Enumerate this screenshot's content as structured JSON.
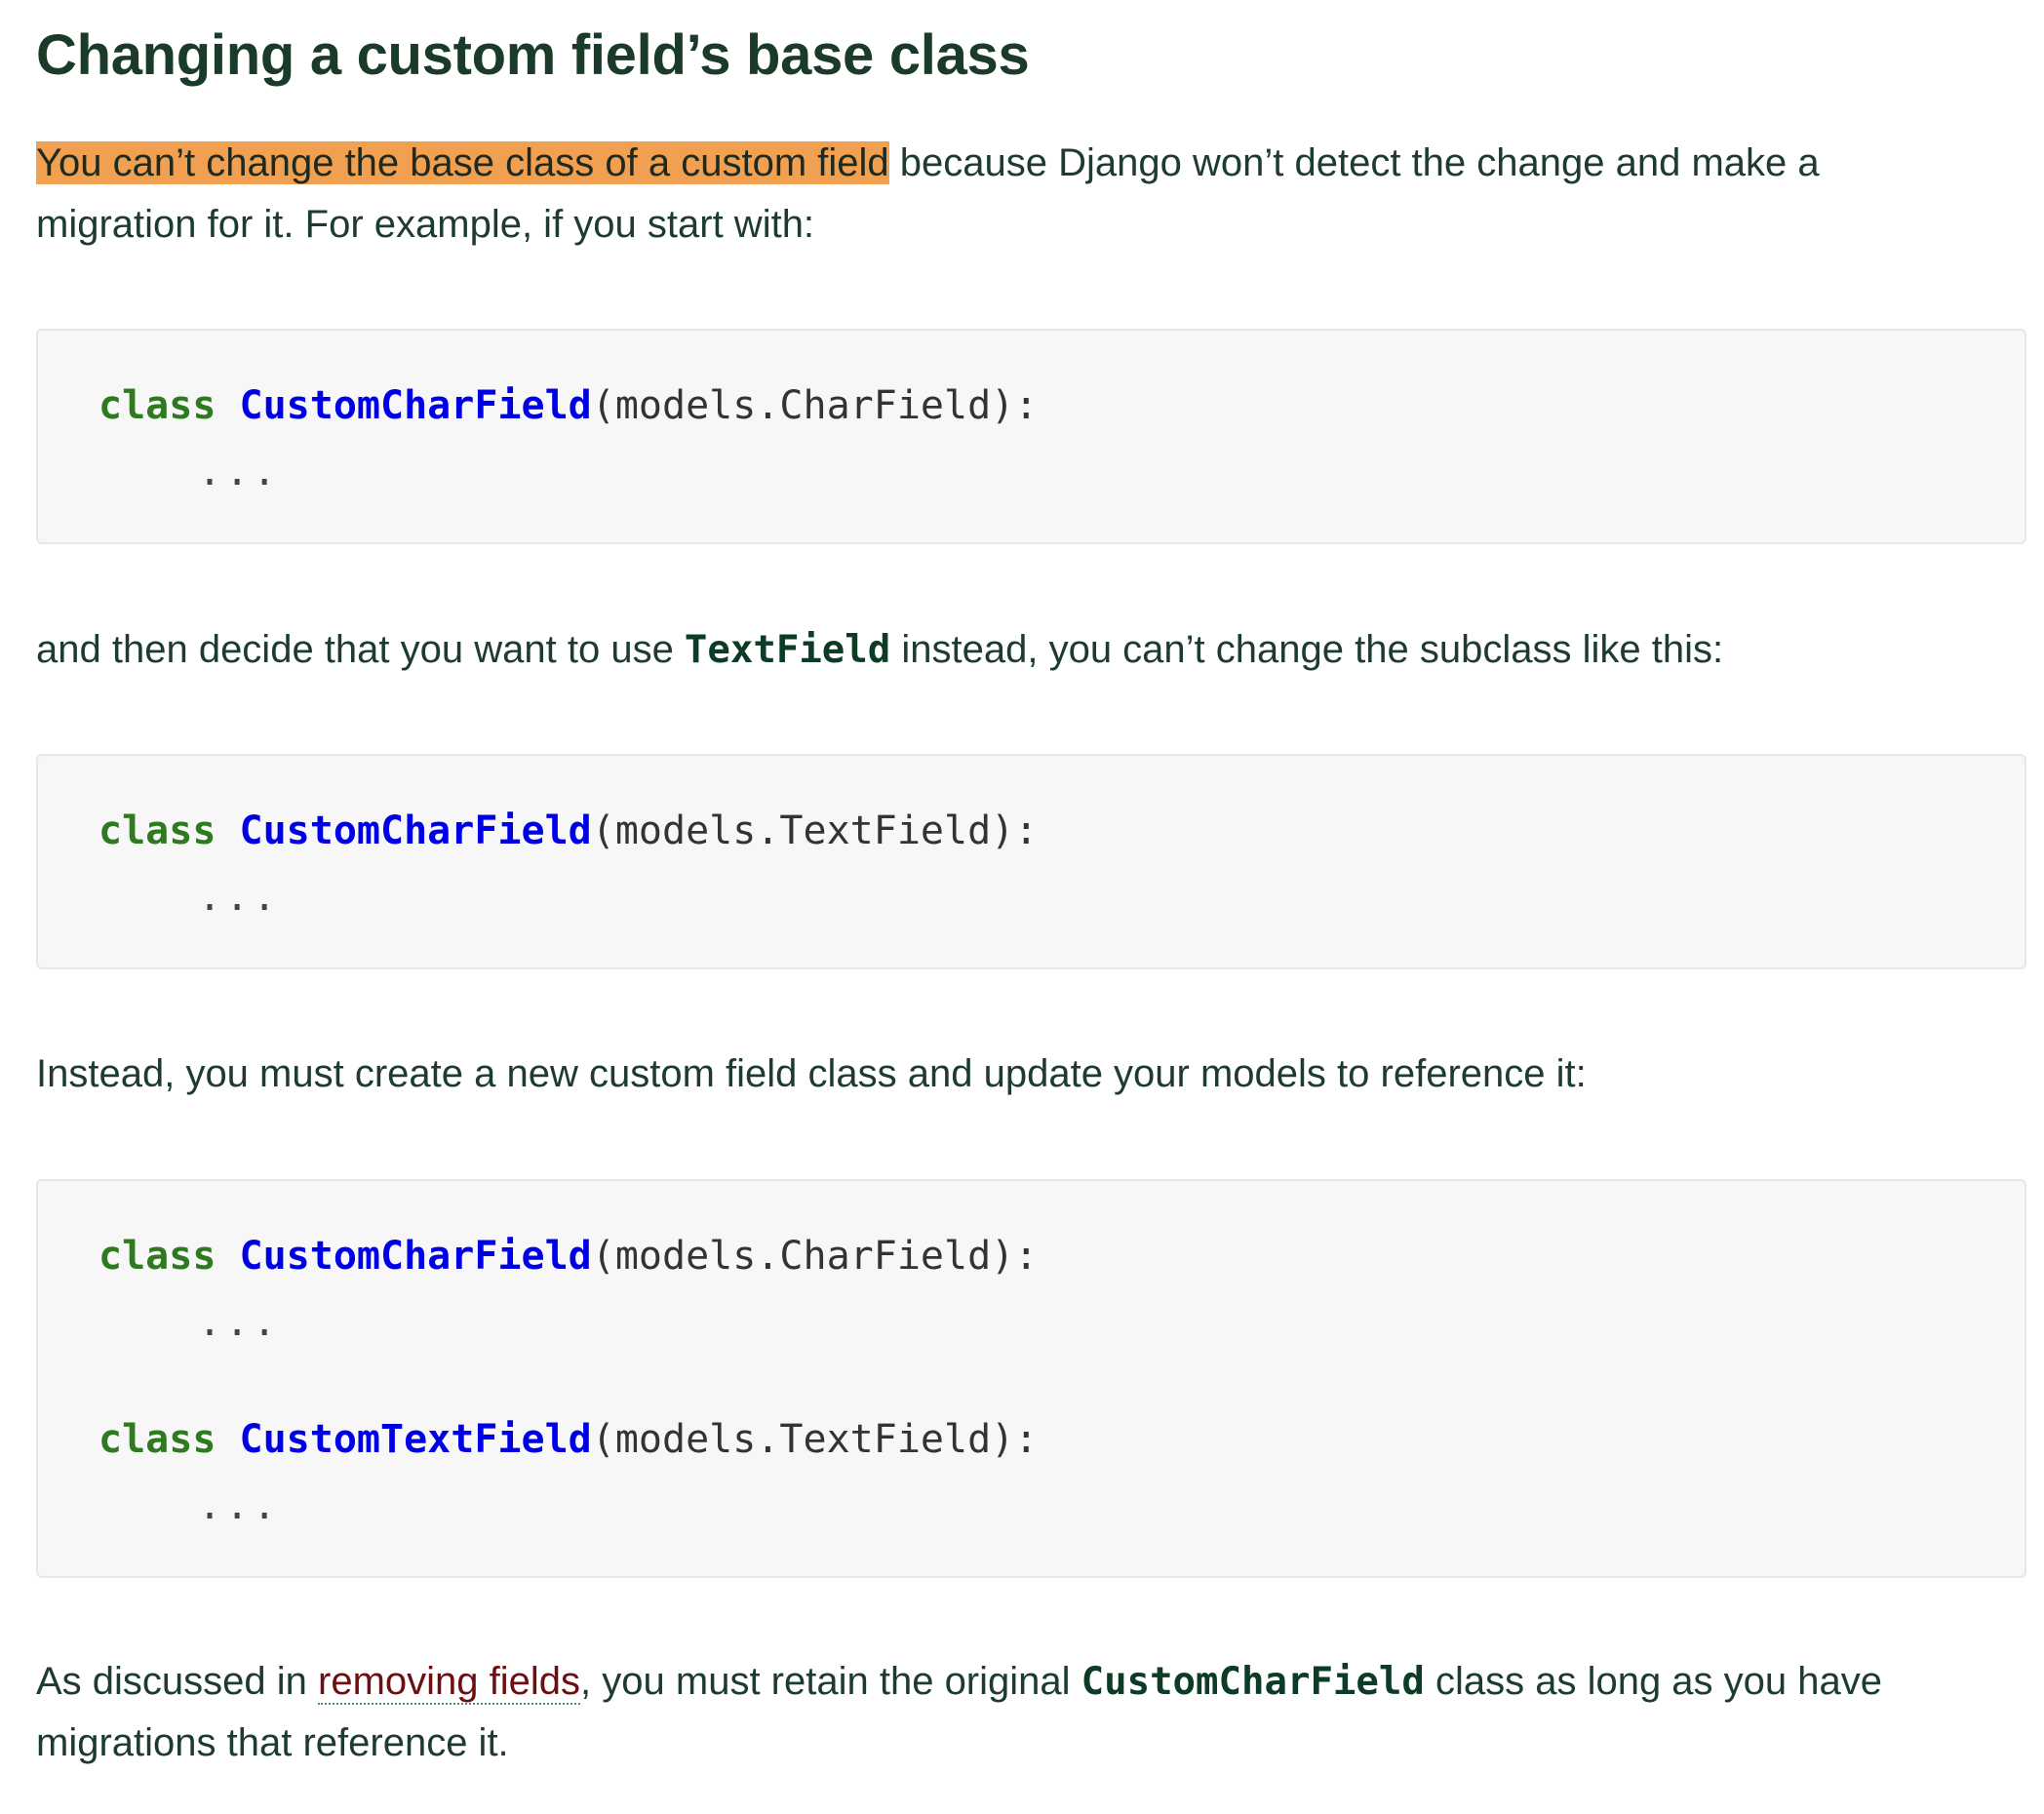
{
  "heading": "Changing a custom field’s base class",
  "para1": {
    "highlight": "You can’t change the base class of a custom field",
    "rest_line1": " because Django won’t detect the change and make a",
    "rest_line2": "migration for it. For example, if you start with:"
  },
  "code1": {
    "kw": "class",
    "name": "CustomCharField",
    "args": "(models.CharField):",
    "body": "..."
  },
  "para2": {
    "before": "and then decide that you want to use ",
    "code": "TextField",
    "after": " instead, you can’t change the subclass like this:"
  },
  "code2": {
    "kw": "class",
    "name": "CustomCharField",
    "args": "(models.TextField):",
    "body": "..."
  },
  "para3": {
    "text": "Instead, you must create a new custom field class and update your models to reference it:"
  },
  "code3": {
    "line1": {
      "kw": "class",
      "name": "CustomCharField",
      "args": "(models.CharField):",
      "body": "..."
    },
    "line2": {
      "kw": "class",
      "name": "CustomTextField",
      "args": "(models.TextField):",
      "body": "..."
    }
  },
  "para4": {
    "before": "As discussed in ",
    "link": "removing fields",
    "middle": ", you must retain the original ",
    "code": "CustomCharField",
    "after_line1": " class as long as you have",
    "line2": "migrations that reference it."
  },
  "colors": {
    "highlight": "#f0a050",
    "keyword": "#2d7a1f",
    "classname": "#0000e6",
    "text": "#1d3c2f",
    "link": "#6b0f12",
    "code_bg": "#f7f7f7"
  }
}
